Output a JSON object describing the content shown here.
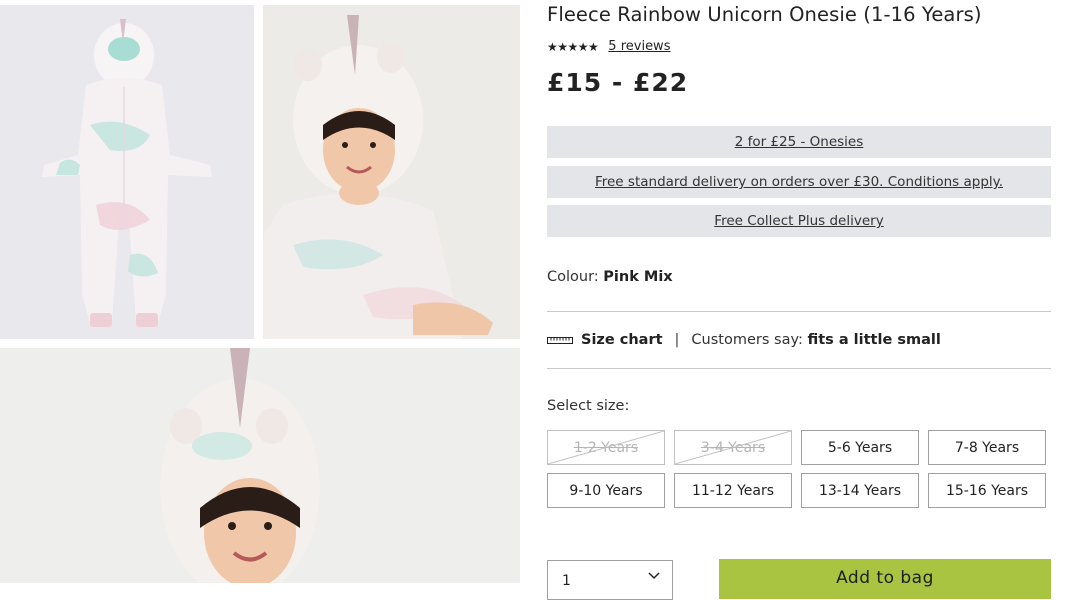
{
  "product": {
    "title": "Fleece Rainbow Unicorn Onesie (1-16 Years)",
    "stars": "★★★★★",
    "reviews": "5 reviews",
    "price": "£15 - £22"
  },
  "promos": [
    "2 for £25 - Onesies",
    "Free standard delivery on orders over £30. Conditions apply.",
    "Free Collect Plus delivery"
  ],
  "colour": {
    "label": "Colour:",
    "value": "Pink Mix"
  },
  "fit": {
    "size_chart": "Size chart",
    "separator": "|",
    "customers_say": "Customers say:",
    "verdict": "fits a little small"
  },
  "sizes": {
    "label": "Select size:",
    "options": [
      {
        "label": "1-2 Years",
        "available": false
      },
      {
        "label": "3-4 Years",
        "available": false
      },
      {
        "label": "5-6 Years",
        "available": true
      },
      {
        "label": "7-8 Years",
        "available": true
      },
      {
        "label": "9-10 Years",
        "available": true
      },
      {
        "label": "11-12 Years",
        "available": true
      },
      {
        "label": "13-14 Years",
        "available": true
      },
      {
        "label": "15-16 Years",
        "available": true
      }
    ]
  },
  "quantity": {
    "value": "1"
  },
  "add_to_bag": "Add to bag",
  "colors": {
    "promo_bg": "#e3e5e8",
    "add_to_bag": "#a8c440",
    "text": "#222222"
  },
  "icons": {
    "ruler": "ruler-icon",
    "chevron": "chevron-down-icon",
    "star": "star-icon"
  }
}
